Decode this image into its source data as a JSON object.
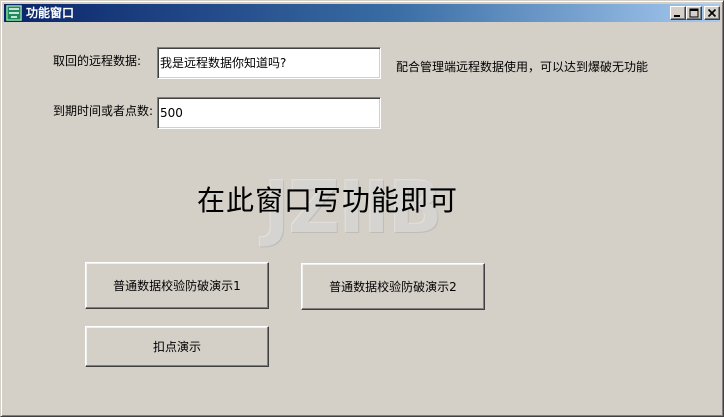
{
  "window": {
    "title": "功能窗口",
    "controls": {
      "minimize": "minimize",
      "maximize": "maximize",
      "close": "close"
    }
  },
  "form": {
    "remote_label": "取回的远程数据:",
    "remote_value": "我是远程数据你知道吗?",
    "remote_hint": "配合管理端远程数据使用，可以达到爆破无功能",
    "expiry_label": "到期时间或者点数:",
    "expiry_value": "500"
  },
  "main": {
    "placeholder_text": "在此窗口写功能即可",
    "watermark": "JZIIB"
  },
  "buttons": {
    "demo1": "普通数据校验防破演示1",
    "demo2": "普通数据校验防破演示2",
    "deduct": "扣点演示"
  }
}
